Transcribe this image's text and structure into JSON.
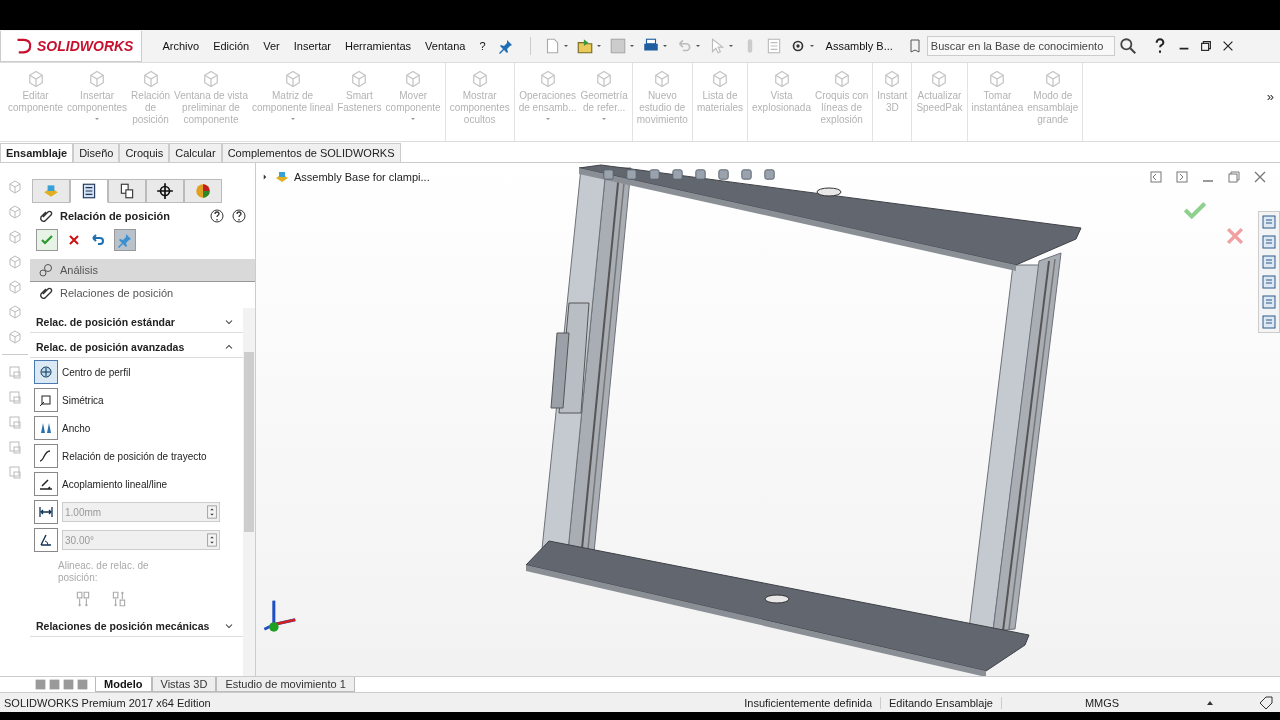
{
  "app": {
    "logo": "SOLIDWORKS",
    "document_title": "Assambly B..."
  },
  "menu": [
    {
      "label": "Archivo"
    },
    {
      "label": "Edición"
    },
    {
      "label": "Ver"
    },
    {
      "label": "Insertar"
    },
    {
      "label": "Herramientas"
    },
    {
      "label": "Ventana"
    },
    {
      "label": "?"
    }
  ],
  "search": {
    "placeholder": "Buscar en la Base de conocimiento"
  },
  "ribbon": {
    "groups": [
      {
        "items": [
          {
            "label": "Editar\ncomponente",
            "has_menu": false,
            "disabled": true
          },
          {
            "label": "Insertar\ncomponentes",
            "has_menu": true,
            "disabled": true
          },
          {
            "label": "Relación\nde\nposición",
            "has_menu": false,
            "disabled": true
          },
          {
            "label": "Ventana de vista\npreliminar de\ncomponente",
            "has_menu": false,
            "disabled": true
          },
          {
            "label": "Matriz de\ncomponente lineal",
            "has_menu": true,
            "disabled": true
          },
          {
            "label": "Smart\nFasteners",
            "has_menu": false,
            "disabled": true
          },
          {
            "label": "Mover\ncomponente",
            "has_menu": true,
            "disabled": true
          }
        ]
      },
      {
        "items": [
          {
            "label": "Mostrar\ncomponentes\nocultos",
            "has_menu": false,
            "disabled": true
          }
        ]
      },
      {
        "items": [
          {
            "label": "Operaciones\nde ensamb...",
            "has_menu": true,
            "disabled": true
          },
          {
            "label": "Geometría\nde refer...",
            "has_menu": true,
            "disabled": true
          }
        ]
      },
      {
        "items": [
          {
            "label": "Nuevo\nestudio de\nmovimiento",
            "has_menu": false,
            "disabled": true
          }
        ]
      },
      {
        "items": [
          {
            "label": "Lista de\nmateriales",
            "has_menu": false,
            "disabled": true
          }
        ]
      },
      {
        "items": [
          {
            "label": "Vista\nexplosionada",
            "has_menu": false,
            "disabled": true
          },
          {
            "label": "Croquis con\nlíneas de\nexplosión",
            "has_menu": false,
            "disabled": true
          }
        ]
      },
      {
        "items": [
          {
            "label": "Instant\n3D",
            "has_menu": false,
            "disabled": true
          }
        ]
      },
      {
        "items": [
          {
            "label": "Actualizar\nSpeedPak",
            "has_menu": false,
            "disabled": true
          }
        ]
      },
      {
        "items": [
          {
            "label": "Tomar\ninstantánea",
            "has_menu": false,
            "disabled": true
          },
          {
            "label": "Modo de\nensamblaje\ngrande",
            "has_menu": false,
            "disabled": true
          }
        ]
      }
    ],
    "more": "»"
  },
  "command_tabs": [
    {
      "label": "Ensamblaje",
      "selected": true
    },
    {
      "label": "Diseño",
      "selected": false
    },
    {
      "label": "Croquis",
      "selected": false
    },
    {
      "label": "Calcular",
      "selected": false
    },
    {
      "label": "Complementos de SOLIDWORKS",
      "selected": false
    }
  ],
  "property_manager": {
    "title": "Relación de posición",
    "rows": [
      {
        "label": "Análisis",
        "selected": true
      },
      {
        "label": "Relaciones de posición",
        "selected": false
      }
    ],
    "sections": [
      {
        "title": "Relac. de posición estándar",
        "expanded": false
      },
      {
        "title": "Relac. de posición avanzadas",
        "expanded": true,
        "items": [
          {
            "kind": "option",
            "label": "Centro de perfil",
            "selected": true
          },
          {
            "kind": "option",
            "label": "Simétrica",
            "selected": false
          },
          {
            "kind": "option",
            "label": "Ancho",
            "selected": false
          },
          {
            "kind": "option",
            "label": "Relación de posición de trayecto",
            "selected": false
          },
          {
            "kind": "option",
            "label": "Acoplamiento lineal/line",
            "selected": false
          },
          {
            "kind": "number",
            "value": "1.00mm",
            "disabled": true
          },
          {
            "kind": "number",
            "value": "30.00°",
            "disabled": true
          },
          {
            "kind": "alignment",
            "label": "Alineac. de relac. de\nposición:",
            "disabled": true
          }
        ]
      },
      {
        "title": "Relaciones de posición mecánicas",
        "expanded": false
      }
    ]
  },
  "tree": {
    "root": "Assembly Base for clampi...",
    "expanded": false
  },
  "bottom_tabs": [
    {
      "label": "Modelo",
      "selected": true
    },
    {
      "label": "Vistas 3D",
      "selected": false
    },
    {
      "label": "Estudio de movimiento 1",
      "selected": false
    }
  ],
  "status_bar": {
    "product": "SOLIDWORKS Premium 2017 x64 Edition",
    "definition": "Insuficientemente definida",
    "mode": "Editando Ensamblaje",
    "units": "MMGS"
  }
}
